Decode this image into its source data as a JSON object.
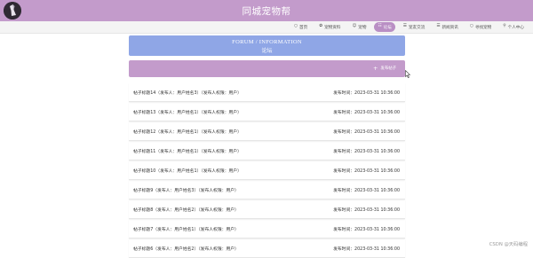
{
  "header": {
    "site_title": "同城宠物帮"
  },
  "nav": {
    "items": [
      {
        "label": "首页",
        "icon": "home-icon",
        "glyph": "○"
      },
      {
        "label": "宠物资料",
        "icon": "paw-icon",
        "glyph": "✿"
      },
      {
        "label": "宠物",
        "icon": "pet-icon",
        "glyph": "☺"
      },
      {
        "label": "论坛",
        "icon": "forum-icon",
        "glyph": "☷"
      },
      {
        "label": "宠友交流",
        "icon": "chat-icon",
        "glyph": "☰"
      },
      {
        "label": "新闻资讯",
        "icon": "news-icon",
        "glyph": "☰"
      },
      {
        "label": "寻找宠物",
        "icon": "search-icon",
        "glyph": "○"
      },
      {
        "label": "个人中心",
        "icon": "user-icon",
        "glyph": "⚲"
      }
    ],
    "active_index": 3
  },
  "banner": {
    "title_en": "FORUM / INFORMATION",
    "title_cn": "论坛"
  },
  "toolbar": {
    "post_button_label": "发布帖子"
  },
  "posts": [
    {
      "title": "帖子标题14（发布人：用户姓名3）（发布人权限：用户）",
      "time": "发布时间：2023-03-31 10:36:00"
    },
    {
      "title": "帖子标题13（发布人：用户姓名1）（发布人权限：用户）",
      "time": "发布时间：2023-03-31 10:36:00"
    },
    {
      "title": "帖子标题12（发布人：用户姓名1）（发布人权限：用户）",
      "time": "发布时间：2023-03-31 10:36:00"
    },
    {
      "title": "帖子标题11（发布人：用户姓名1）（发布人权限：用户）",
      "time": "发布时间：2023-03-31 10:36:00"
    },
    {
      "title": "帖子标题10（发布人：用户姓名1）（发布人权限：用户）",
      "time": "发布时间：2023-03-31 10:36:00"
    },
    {
      "title": "帖子标题9（发布人：用户姓名3）（发布人权限：用户）",
      "time": "发布时间：2023-03-31 10:36:00"
    },
    {
      "title": "帖子标题8（发布人：用户姓名2）（发布人权限：用户）",
      "time": "发布时间：2023-03-31 10:36:00"
    },
    {
      "title": "帖子标题7（发布人：用户姓名1）（发布人权限：用户）",
      "time": "发布时间：2023-03-31 10:36:00"
    },
    {
      "title": "帖子标题6（发布人：用户姓名2）（发布人权限：用户）",
      "time": "发布时间：2023-03-31 10:36:00"
    }
  ],
  "watermark": "CSDN @天码编程",
  "colors": {
    "header": "#c39bcb",
    "banner": "#8fa6e6",
    "toolbar": "#c39bcb",
    "nav_active": "#b98fc4"
  }
}
